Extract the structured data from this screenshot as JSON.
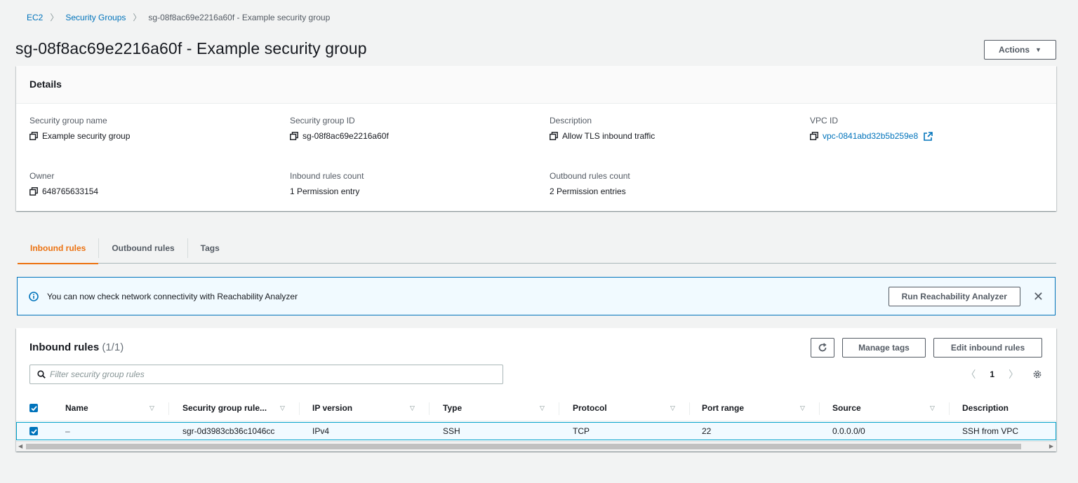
{
  "breadcrumb": {
    "items": [
      "EC2",
      "Security Groups"
    ],
    "current": "sg-08f8ac69e2216a60f - Example security group"
  },
  "header": {
    "title": "sg-08f8ac69e2216a60f - Example security group",
    "actions_label": "Actions"
  },
  "details": {
    "title": "Details",
    "fields": [
      {
        "label": "Security group name",
        "value": "Example security group"
      },
      {
        "label": "Security group ID",
        "value": "sg-08f8ac69e2216a60f"
      },
      {
        "label": "Description",
        "value": "Allow TLS inbound traffic"
      },
      {
        "label": "VPC ID",
        "value": "vpc-0841abd32b5b259e8"
      },
      {
        "label": "Owner",
        "value": "648765633154"
      },
      {
        "label": "Inbound rules count",
        "value": "1 Permission entry"
      },
      {
        "label": "Outbound rules count",
        "value": "2 Permission entries"
      }
    ]
  },
  "tabs": [
    "Inbound rules",
    "Outbound rules",
    "Tags"
  ],
  "alert": {
    "text": "You can now check network connectivity with Reachability Analyzer",
    "button_label": "Run Reachability Analyzer"
  },
  "rules": {
    "title": "Inbound rules",
    "count": "(1/1)",
    "manage_tags_label": "Manage tags",
    "edit_label": "Edit inbound rules",
    "search_placeholder": "Filter security group rules",
    "page": "1",
    "columns": [
      "Name",
      "Security group rule...",
      "IP version",
      "Type",
      "Protocol",
      "Port range",
      "Source",
      "Description"
    ],
    "rows": [
      [
        "–",
        "sgr-0d3983cb36c1046cc",
        "IPv4",
        "SSH",
        "TCP",
        "22",
        "0.0.0.0/0",
        "SSH from VPC"
      ]
    ]
  },
  "colors": {
    "accent_orange": "#ec7211",
    "link_blue": "#0073bb",
    "info_bg": "#f1faff"
  }
}
